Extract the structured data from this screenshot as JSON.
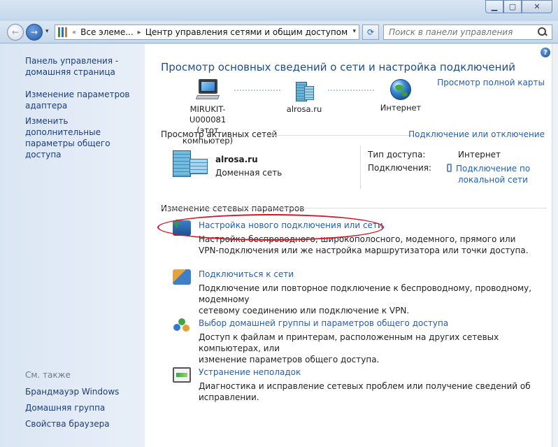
{
  "window": {
    "minimize": "▁",
    "maximize": "▢",
    "close": "✕"
  },
  "nav": {
    "back_glyph": "←",
    "forward_glyph": "→",
    "history_glyph": "▾",
    "breadcrumb": [
      "Все элеме...",
      "Центр управления сетями и общим доступом"
    ],
    "breadcrumb_lead": "«",
    "breadcrumb_sep": "▸",
    "dropdown_glyph": "▾",
    "refresh_glyph": "⟳",
    "search_placeholder": "Поиск в панели управления"
  },
  "sidebar": {
    "items": [
      {
        "label_1": "Панель управления -",
        "label_2": "домашняя страница"
      },
      {
        "label_1": "Изменение параметров",
        "label_2": "адаптера"
      },
      {
        "label_1": "Изменить дополнительные",
        "label_2": "параметры общего доступа"
      }
    ],
    "see_also": "См. также",
    "see_also_items": [
      "Брандмауэр Windows",
      "Домашняя группа",
      "Свойства браузера"
    ]
  },
  "main": {
    "help": "?",
    "title": "Просмотр основных сведений о сети и настройка подключений",
    "full_map": "Просмотр полной карты",
    "map": {
      "computer_line1": "MIRUKIT-U000081",
      "computer_line2": "(этот компьютер)",
      "network": "alrosa.ru",
      "internet": "Интернет"
    },
    "active_networks": {
      "heading": "Просмотр активных сетей",
      "connect_link": "Подключение или отключение",
      "network_name": "alrosa.ru",
      "network_type": "Доменная сеть",
      "access_type_label": "Тип доступа:",
      "access_type_value": "Интернет",
      "connections_label": "Подключения:",
      "connection_link_1": "Подключение по",
      "connection_link_2": "локальной сети"
    },
    "change_settings": {
      "heading": "Изменение сетевых параметров",
      "tasks": [
        {
          "title": "Настройка нового подключения или сети",
          "desc_1": "Настройка беспроводного, широкополосного, модемного, прямого или",
          "desc_2": "VPN-подключения или же настройка маршрутизатора или точки доступа."
        },
        {
          "title": "Подключиться к сети",
          "desc_1": "Подключение или повторное подключение к беспроводному, проводному, модемному",
          "desc_2": "сетевому соединению или подключение к VPN."
        },
        {
          "title": "Выбор домашней группы и параметров общего доступа",
          "desc_1": "Доступ к файлам и принтерам, расположенным на других сетевых компьютерах, или",
          "desc_2": "изменение параметров общего доступа."
        },
        {
          "title": "Устранение неполадок",
          "desc_1": "Диагностика и исправление сетевых проблем или получение сведений об исправлении.",
          "desc_2": ""
        }
      ]
    }
  },
  "colors": {
    "link": "#1f5fb7",
    "title": "#1c4c8e",
    "highlight": "#d3152a"
  }
}
